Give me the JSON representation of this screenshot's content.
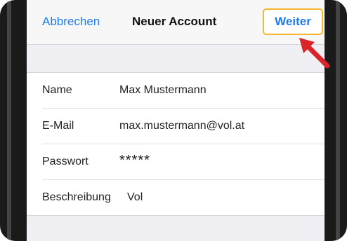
{
  "navbar": {
    "cancel_label": "Abbrechen",
    "title": "Neuer Account",
    "next_label": "Weiter"
  },
  "form": {
    "rows": [
      {
        "label": "Name",
        "value": "Max Mustermann"
      },
      {
        "label": "E-Mail",
        "value": "max.mustermann@vol.at"
      },
      {
        "label": "Passwort",
        "value": "*****"
      },
      {
        "label": "Beschreibung",
        "value": "Vol"
      }
    ]
  },
  "colors": {
    "accent": "#1e7cf2",
    "highlight": "#f5b731",
    "arrow": "#d9252a"
  },
  "icons": {
    "annotation": "red-arrow-icon"
  }
}
